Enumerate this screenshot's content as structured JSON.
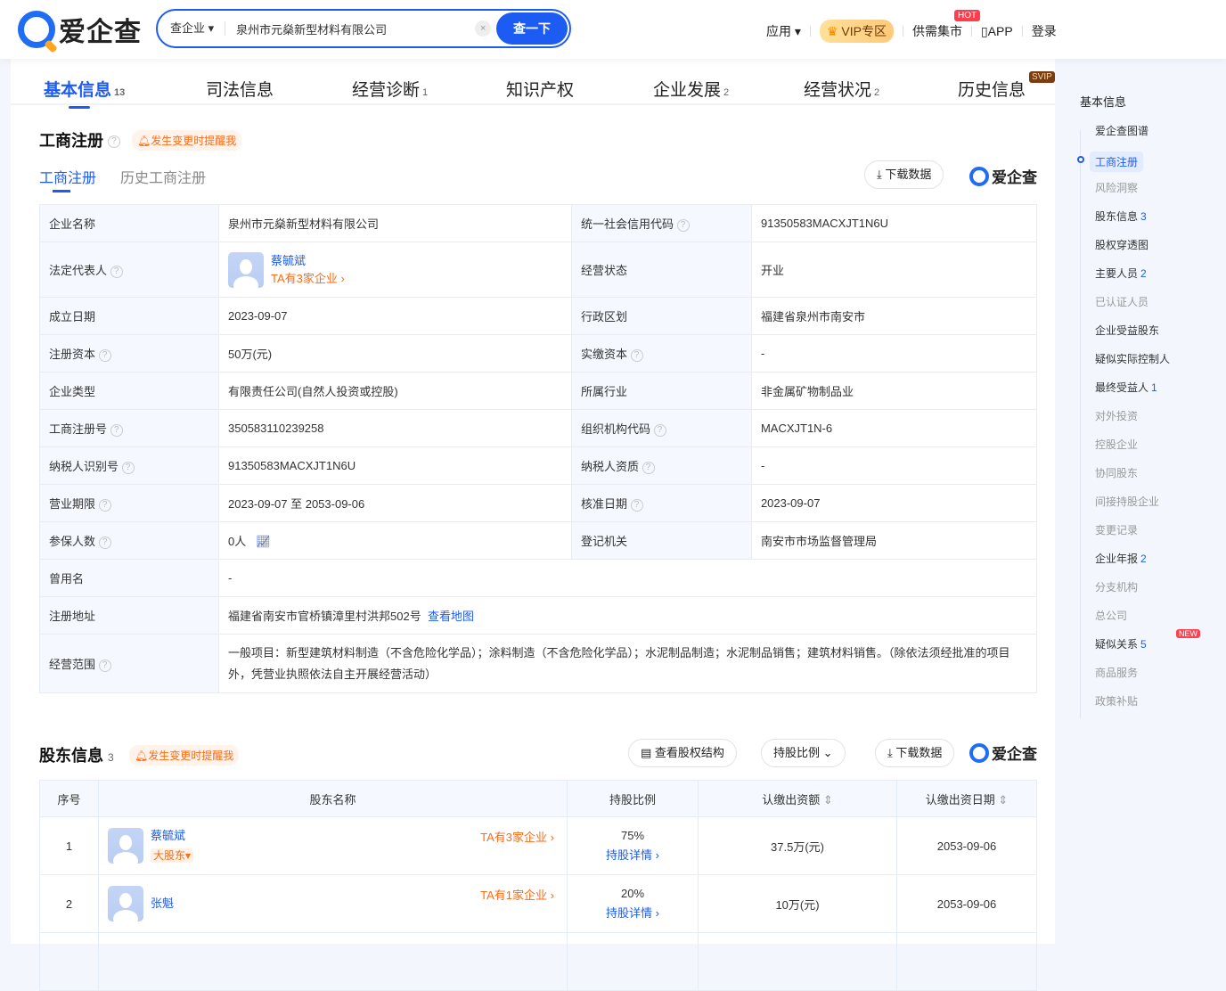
{
  "header": {
    "logo": "爱企查",
    "search_type": "查企业",
    "search_value": "泉州市元燊新型材料有限公司",
    "search_button": "查一下",
    "nav": [
      "应用",
      "VIP专区",
      "供需集市",
      "APP",
      "登录"
    ],
    "hot": "HOT"
  },
  "tabs": [
    {
      "label": "基本信息",
      "count": "13"
    },
    {
      "label": "司法信息",
      "count": ""
    },
    {
      "label": "经营诊断",
      "count": "1"
    },
    {
      "label": "知识产权",
      "count": ""
    },
    {
      "label": "企业发展",
      "count": "2"
    },
    {
      "label": "经营状况",
      "count": "2"
    },
    {
      "label": "历史信息",
      "count": ""
    }
  ],
  "svip": "SVIP",
  "reg": {
    "title": "工商注册",
    "remind": "发生变更时提醒我",
    "subtabs": [
      "工商注册",
      "历史工商注册"
    ],
    "download": "下载数据",
    "brand": "爱企查",
    "rows": [
      [
        {
          "k": "企业名称",
          "v": "泉州市元燊新型材料有限公司"
        },
        {
          "k": "统一社会信用代码",
          "h": 1,
          "v": "91350583MACXJT1N6U"
        }
      ],
      [
        {
          "k": "法定代表人",
          "h": 1,
          "v": "__legal"
        },
        {
          "k": "经营状态",
          "v": "开业"
        }
      ],
      [
        {
          "k": "成立日期",
          "v": "2023-09-07"
        },
        {
          "k": "行政区划",
          "v": "福建省泉州市南安市"
        }
      ],
      [
        {
          "k": "注册资本",
          "h": 1,
          "v": "50万(元)"
        },
        {
          "k": "实缴资本",
          "h": 1,
          "v": "-"
        }
      ],
      [
        {
          "k": "企业类型",
          "v": "有限责任公司(自然人投资或控股)"
        },
        {
          "k": "所属行业",
          "v": "非金属矿物制品业"
        }
      ],
      [
        {
          "k": "工商注册号",
          "h": 1,
          "v": "350583110239258"
        },
        {
          "k": "组织机构代码",
          "h": 1,
          "v": "MACXJT1N-6"
        }
      ],
      [
        {
          "k": "纳税人识别号",
          "h": 1,
          "v": "91350583MACXJT1N6U"
        },
        {
          "k": "纳税人资质",
          "h": 1,
          "v": "-"
        }
      ],
      [
        {
          "k": "营业期限",
          "h": 1,
          "v": "2023-09-07 至 2053-09-06"
        },
        {
          "k": "核准日期",
          "h": 1,
          "v": "2023-09-07"
        }
      ],
      [
        {
          "k": "参保人数",
          "h": 1,
          "v": "0人"
        },
        {
          "k": "登记机关",
          "v": "南安市市场监督管理局"
        }
      ],
      [
        {
          "k": "曾用名",
          "v": "-"
        }
      ],
      [
        {
          "k": "注册地址",
          "v": "福建省南安市官桥镇漳里村洪邦502号",
          "link": "查看地图"
        }
      ],
      [
        {
          "k": "经营范围",
          "h": 1,
          "v": "一般项目：新型建筑材料制造（不含危险化学品）；涂料制造（不含危险化学品）；水泥制品制造；水泥制品销售；建筑材料销售。（除依法须经批准的项目外，凭营业执照依法自主开展经营活动）"
        }
      ]
    ],
    "legal": {
      "name": "蔡毓斌",
      "companies": "TA有3家企业"
    }
  },
  "shareholders": {
    "title": "股东信息",
    "count": "3",
    "remind": "发生变更时提醒我",
    "buttons": [
      "查看股权结构",
      "持股比例",
      "下载数据"
    ],
    "brand": "爱企查",
    "headers": [
      "序号",
      "股东名称",
      "持股比例",
      "认缴出资额",
      "认缴出资日期"
    ],
    "rows": [
      {
        "no": "1",
        "name": "蔡毓斌",
        "tag": "大股东",
        "companies": "TA有3家企业",
        "ratio": "75%",
        "detail": "持股详情",
        "amount": "37.5万(元)",
        "date": "2053-09-06"
      },
      {
        "no": "2",
        "name": "张魁",
        "tag": "",
        "companies": "TA有1家企业",
        "ratio": "20%",
        "detail": "持股详情",
        "amount": "10万(元)",
        "date": "2053-09-06"
      }
    ]
  },
  "sidebar": {
    "title": "基本信息",
    "items": [
      {
        "label": "爱企查图谱",
        "count": "",
        "dim": false
      },
      {
        "label": "工商注册",
        "count": "",
        "active": true
      },
      {
        "label": "风险洞察",
        "count": "",
        "dim": true
      },
      {
        "label": "股东信息",
        "count": "3"
      },
      {
        "label": "股权穿透图",
        "count": ""
      },
      {
        "label": "主要人员",
        "count": "2"
      },
      {
        "label": "已认证人员",
        "count": "",
        "dim": true
      },
      {
        "label": "企业受益股东",
        "count": ""
      },
      {
        "label": "疑似实际控制人",
        "count": ""
      },
      {
        "label": "最终受益人",
        "count": "1"
      },
      {
        "label": "对外投资",
        "count": "",
        "dim": true
      },
      {
        "label": "控股企业",
        "count": "",
        "dim": true
      },
      {
        "label": "协同股东",
        "count": "",
        "dim": true
      },
      {
        "label": "间接持股企业",
        "count": "",
        "dim": true
      },
      {
        "label": "变更记录",
        "count": "",
        "dim": true
      },
      {
        "label": "企业年报",
        "count": "2"
      },
      {
        "label": "分支机构",
        "count": "",
        "dim": true
      },
      {
        "label": "总公司",
        "count": "",
        "dim": true
      },
      {
        "label": "疑似关系",
        "count": "5",
        "badge": "NEW"
      },
      {
        "label": "商品服务",
        "count": "",
        "dim": true
      },
      {
        "label": "政策补贴",
        "count": "",
        "dim": true
      }
    ]
  },
  "colors": {
    "accent": "#1d5cf2",
    "orange": "#ff6a13"
  }
}
